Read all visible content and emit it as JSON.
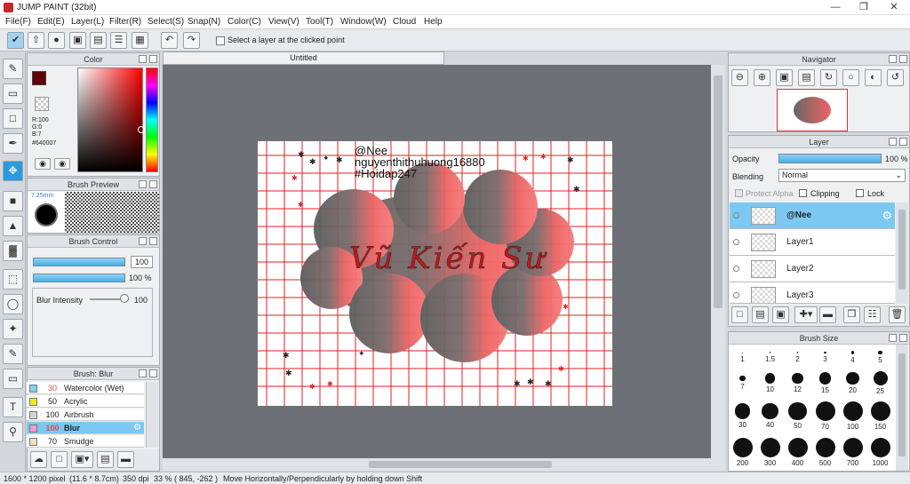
{
  "app": {
    "title": "JUMP PAINT (32bit)"
  },
  "menu": [
    "File(F)",
    "Edit(E)",
    "Layer(L)",
    "Filter(R)",
    "Select(S)",
    "Snap(N)",
    "Color(C)",
    "View(V)",
    "Tool(T)",
    "Window(W)",
    "Cloud",
    "Help"
  ],
  "toolbar": {
    "select_layer_label": "Select a layer at the clicked point"
  },
  "color_panel": {
    "title": "Color",
    "r": "R:100",
    "g": "G:0",
    "b": "B:7",
    "hex": "#640007",
    "fg": "#640007"
  },
  "brush_preview": {
    "title": "Brush Preview",
    "size": "7.25mm"
  },
  "brush_control": {
    "title": "Brush Control",
    "size_value": "100",
    "opacity_value": "100 %",
    "blur_label": "Blur Intensity",
    "blur_value": "100"
  },
  "brush_list": {
    "title": "Brush: Blur",
    "items": [
      {
        "num": "30",
        "name": "Watercolor (Wet)",
        "color": "#7fd3ef"
      },
      {
        "num": "50",
        "name": "Acrylic",
        "color": "#f1ea22"
      },
      {
        "num": "100",
        "name": "Airbrush",
        "color": "#cfd3d6"
      },
      {
        "num": "100",
        "name": "Blur",
        "color": "#f79ad2"
      },
      {
        "num": "70",
        "name": "Smudge",
        "color": "#f6dcc0"
      }
    ]
  },
  "document": {
    "tab": "Untitled"
  },
  "artwork": {
    "line1": "@Nee",
    "line2": "nguyenthithuhuong16880",
    "line3": "#Hoidap247",
    "signature": "Vũ Kiến Sư"
  },
  "navigator": {
    "title": "Navigator"
  },
  "layer_panel": {
    "title": "Layer",
    "opacity_label": "Opacity",
    "opacity_value": "100 %",
    "blending_label": "Blending",
    "blending_value": "Normal",
    "protect_alpha": "Protect Alpha",
    "clipping": "Clipping",
    "lock": "Lock",
    "layers": [
      {
        "name": "@Nee"
      },
      {
        "name": "Layer1"
      },
      {
        "name": "Layer2"
      },
      {
        "name": "Layer3"
      }
    ]
  },
  "brush_size": {
    "title": "Brush Size",
    "sizes": [
      "1",
      "1.5",
      "2",
      "3",
      "4",
      "5",
      "7",
      "10",
      "12",
      "15",
      "20",
      "25",
      "30",
      "40",
      "50",
      "70",
      "100",
      "150",
      "200",
      "300",
      "400",
      "500",
      "700",
      "1000"
    ]
  },
  "status": {
    "pixels": "1600 * 1200 pixel",
    "physical": "(11.6 * 8.7cm)",
    "dpi": "350 dpi",
    "zoom": "33 %",
    "coords": "( 845, -262 )",
    "hint": "Move Horizontally/Perpendicularly by holding down Shift"
  }
}
